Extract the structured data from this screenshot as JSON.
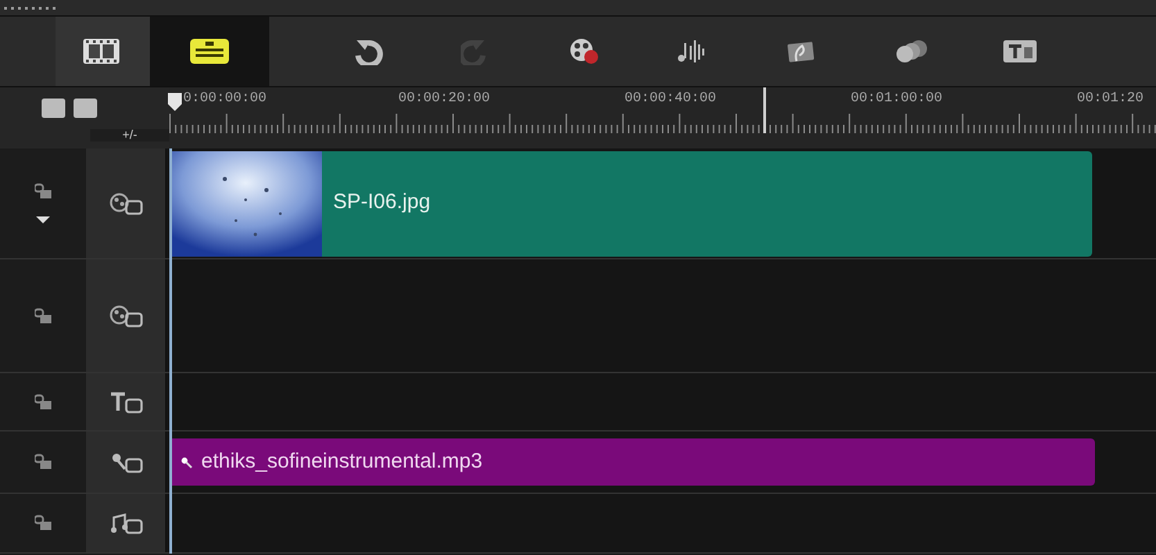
{
  "view_tabs": [
    {
      "kind": "storyboard",
      "selected": false
    },
    {
      "kind": "timeline",
      "selected": true
    }
  ],
  "toolbar": [
    {
      "kind": "undo",
      "disabled": false
    },
    {
      "kind": "redo",
      "disabled": true
    },
    {
      "kind": "record",
      "disabled": false
    },
    {
      "kind": "audio",
      "disabled": false
    },
    {
      "kind": "score",
      "disabled": false
    },
    {
      "kind": "merge",
      "disabled": false
    },
    {
      "kind": "title",
      "disabled": false
    }
  ],
  "zoom_control": "+/-",
  "ruler": {
    "labels": [
      "0:00:00:00",
      "00:00:20:00",
      "00:00:40:00",
      "00:01:00:00",
      "00:01:20"
    ]
  },
  "tracks": [
    {
      "kind": "video",
      "expanded": true,
      "clip": {
        "kind": "picture",
        "label": "SP-I06.jpg"
      }
    },
    {
      "kind": "overlay",
      "expanded": false
    },
    {
      "kind": "title",
      "expanded": false
    },
    {
      "kind": "voice",
      "expanded": false,
      "clip": {
        "kind": "audio",
        "label": "ethiks_sofineinstrumental.mp3"
      }
    },
    {
      "kind": "music",
      "expanded": false
    }
  ]
}
